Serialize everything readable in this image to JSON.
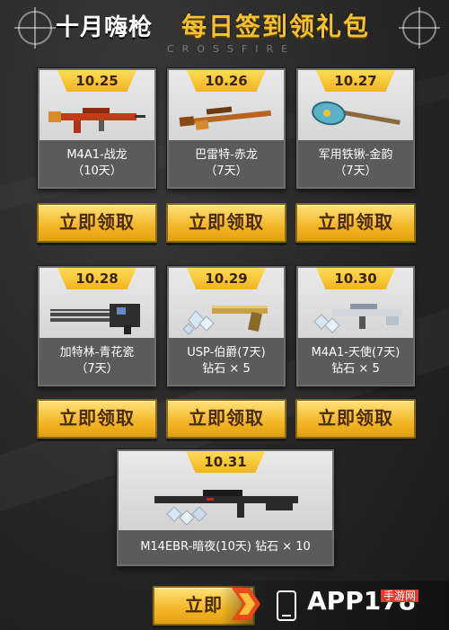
{
  "header": {
    "title_left": "十月嗨枪",
    "title_right": "每日签到领礼包",
    "subtitle": "CROSSFIRE"
  },
  "cards": [
    {
      "date": "10.25",
      "line1": "M4A1-战龙",
      "line2": "（10天）",
      "weapon_icon": "rifle-icon",
      "button": "立即领取"
    },
    {
      "date": "10.26",
      "line1": "巴雷特-赤龙",
      "line2": "（7天）",
      "weapon_icon": "sniper-rifle-icon",
      "button": "立即领取"
    },
    {
      "date": "10.27",
      "line1": "军用铁锹-金韵",
      "line2": "（7天）",
      "weapon_icon": "shovel-icon",
      "button": "立即领取"
    },
    {
      "date": "10.28",
      "line1": "加特林-青花瓷",
      "line2": "（7天）",
      "weapon_icon": "gatling-gun-icon",
      "button": "立即领取"
    },
    {
      "date": "10.29",
      "line1": "USP-伯爵(7天)",
      "line2": "钻石 × 5",
      "weapon_icon": "pistol-with-diamonds-icon",
      "button": "立即领取"
    },
    {
      "date": "10.30",
      "line1": "M4A1-天使(7天)",
      "line2": "钻石 × 5",
      "weapon_icon": "rifle-with-diamonds-icon",
      "button": "立即领取"
    }
  ],
  "featured": {
    "date": "10.31",
    "caption": "M14EBR-暗夜(10天) 钻石 × 10",
    "weapon_icon": "marksman-rifle-with-diamonds-icon",
    "button": "立即"
  },
  "watermark": {
    "brand": "APP178",
    "brand_cn": "手游网"
  },
  "colors": {
    "accent_gold": "#f2b625",
    "background": "#262626",
    "card_caption": "#5b5b5b"
  }
}
